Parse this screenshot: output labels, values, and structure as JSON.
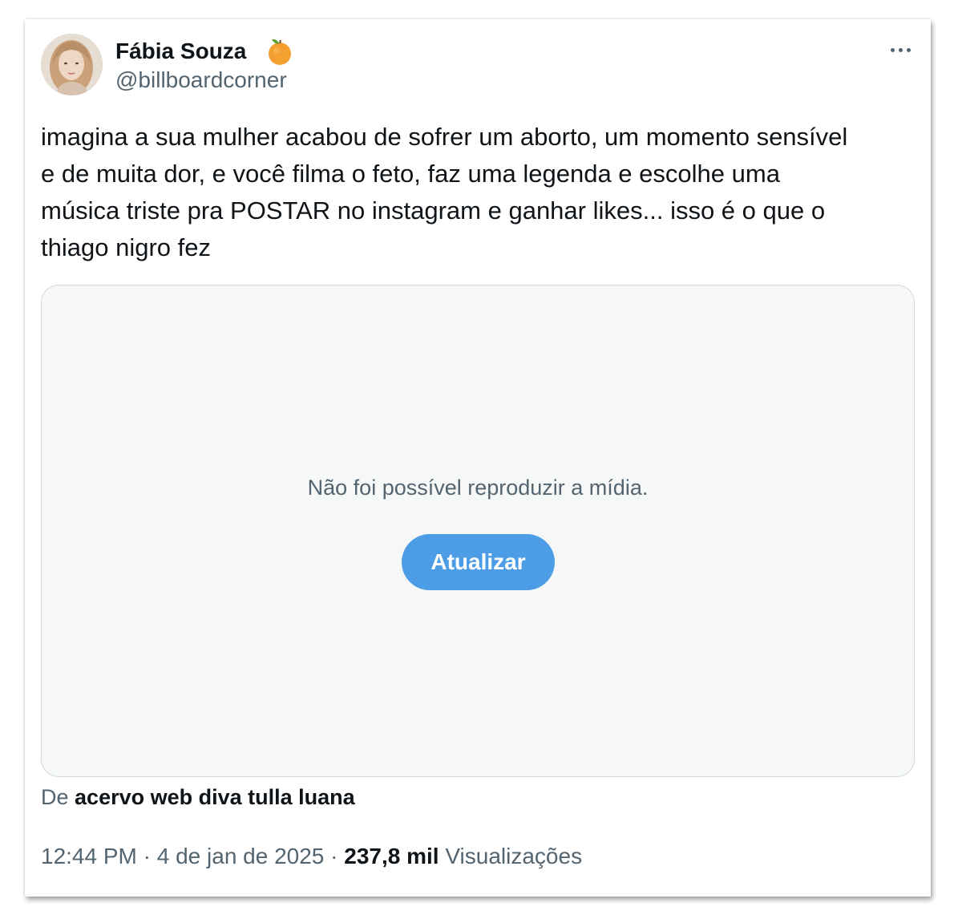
{
  "author": {
    "name": "Fábia Souza",
    "handle": "@billboardcorner",
    "badge_icon": "orange-emoji-icon"
  },
  "menu": {
    "icon": "more-options-icon"
  },
  "tweet": {
    "line1": "imagina a sua mulher acabou de sofrer um aborto, um momento sensível",
    "line2": "e de muita dor, e você filma o feto, faz uma legenda e escolhe uma",
    "line3": "música triste pra POSTAR no instagram e ganhar likes... isso é o que o",
    "line4": "thiago nigro fez"
  },
  "media": {
    "error_message": "Não foi possível reproduzir a mídia.",
    "refresh_label": "Atualizar"
  },
  "source": {
    "prefix": "De",
    "name": "acervo web diva tulla luana"
  },
  "meta": {
    "time": "12:44 PM",
    "separator1": "·",
    "date": "4 de jan de 2025",
    "separator2": "·",
    "views_count": "237,8 mil",
    "views_label": "Visualizações"
  },
  "colors": {
    "text_primary": "#0f1419",
    "text_secondary": "#536471",
    "button_blue": "#4d9de6",
    "media_bg": "#f6f7f7"
  }
}
